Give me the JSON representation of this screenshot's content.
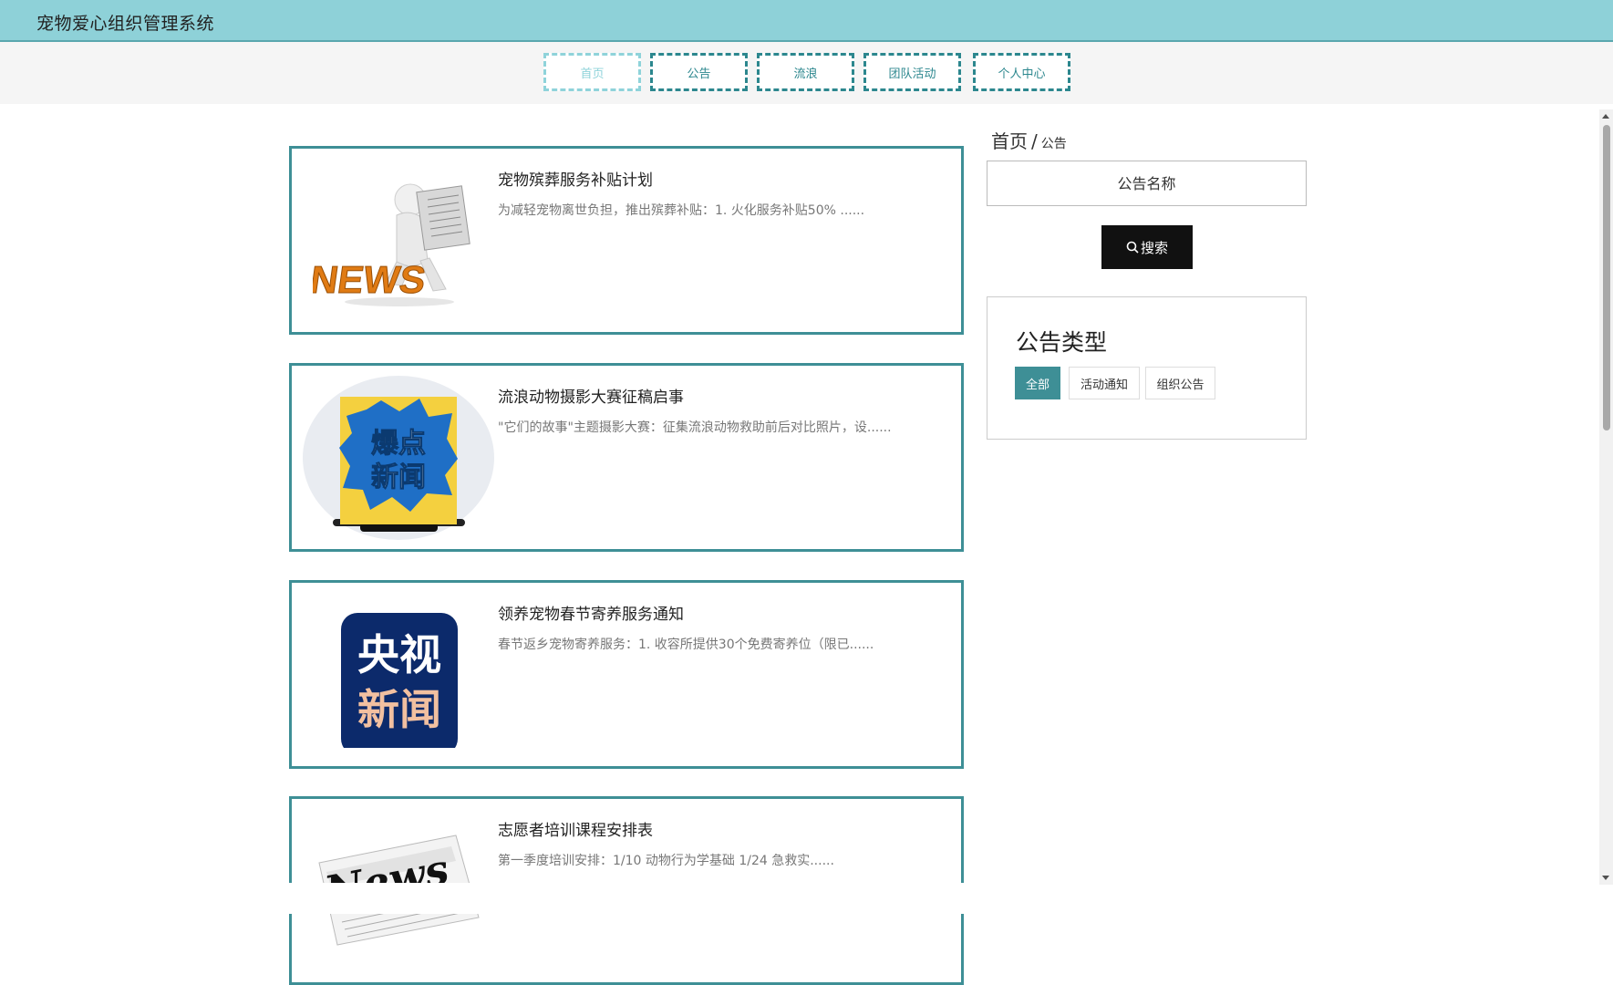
{
  "app": {
    "title": "宠物爱心组织管理系统"
  },
  "nav": {
    "items": [
      {
        "label": "首页"
      },
      {
        "label": "公告"
      },
      {
        "label": "流浪"
      },
      {
        "label": "团队活动"
      },
      {
        "label": "个人中心"
      }
    ],
    "active_index": 0
  },
  "breadcrumb": {
    "home": "首页",
    "separator": "/",
    "current": "公告"
  },
  "search": {
    "placeholder": "公告名称",
    "button_label": "搜索",
    "icon": "search-icon"
  },
  "notice_types": {
    "title": "公告类型",
    "items": [
      {
        "label": "全部",
        "active": true
      },
      {
        "label": "活动通知",
        "active": false
      },
      {
        "label": "组织公告",
        "active": false
      }
    ]
  },
  "notices": [
    {
      "title": "宠物殡葬服务补贴计划",
      "summary": "为减轻宠物离世负担，推出殡葬补贴：1. 火化服务补贴50% ......",
      "image": "news-man-reading-image",
      "image_text": "NEWS"
    },
    {
      "title": "流浪动物摄影大赛征稿启事",
      "summary": "\"它们的故事\"主题摄影大赛：征集流浪动物救助前后对比照片，设......",
      "image": "breaking-news-image",
      "image_text": "爆点新闻"
    },
    {
      "title": "领养宠物春节寄养服务通知",
      "summary": "春节返乡宠物寄养服务：1. 收容所提供30个免费寄养位（限已......",
      "image": "cctv-news-logo-image",
      "image_text": "央视新闻"
    },
    {
      "title": "志愿者培训课程安排表",
      "summary": "第一季度培训安排：1/10 动物行为学基础 1/24 急救实......",
      "image": "newspaper-image",
      "image_text": "News"
    }
  ],
  "colors": {
    "topbar": "#8ed1d8",
    "accent": "#3e8f96",
    "nav_border": "#2c878e",
    "nav_active": "#8fd3da",
    "search_button": "#111111"
  }
}
